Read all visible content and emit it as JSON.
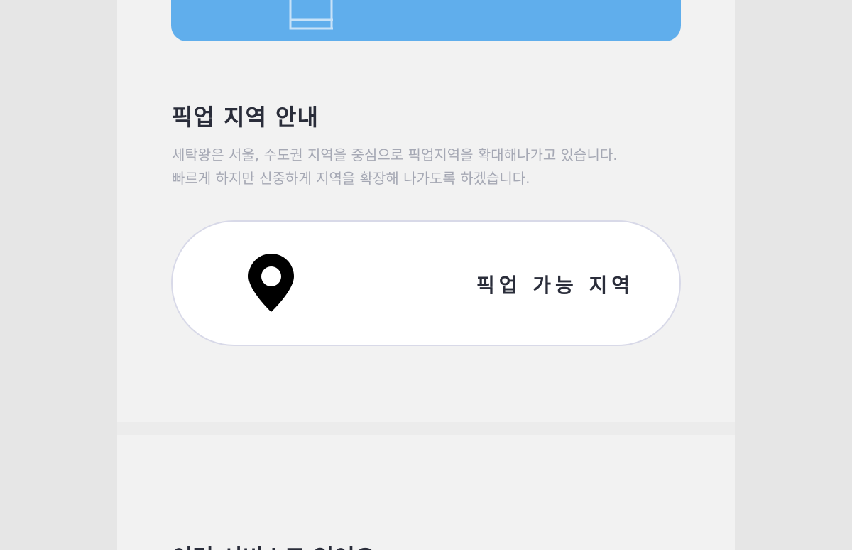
{
  "banner": {
    "icon": "box-outline-icon",
    "color": "#60aeec"
  },
  "pickup_section": {
    "title": "픽업 지역 안내",
    "description_line1": "세탁왕은 서울, 수도권 지역을 중심으로 픽업지역을 확대해나가고 있습니다.",
    "description_line2": "빠르게 하지만 신중하게 지역을 확장해 나가도록 하겠습니다.",
    "button_label": "픽업 가능 지역",
    "button_icon": "map-pin-icon"
  },
  "next_section": {
    "title": "이런 서비스도 있어요"
  }
}
